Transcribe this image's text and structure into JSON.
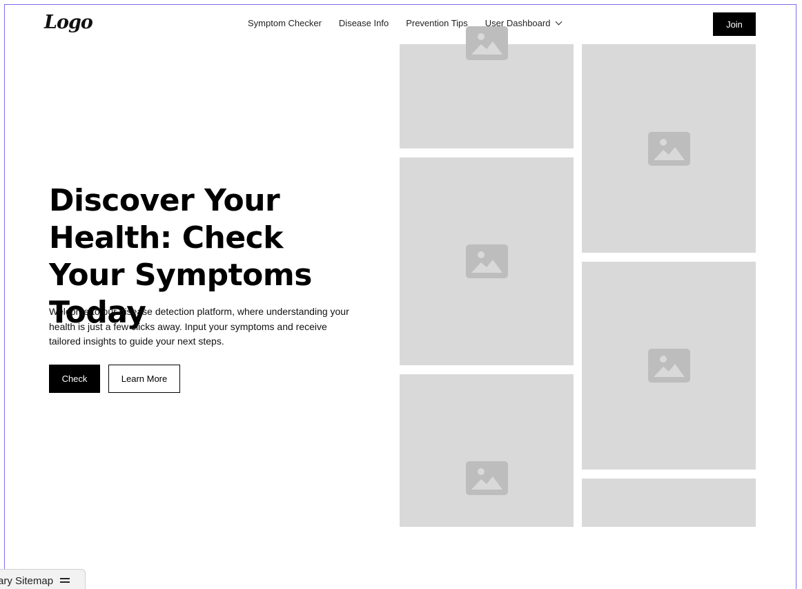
{
  "nav": {
    "logo": "Logo",
    "links": [
      "Symptom Checker",
      "Disease Info",
      "Prevention Tips"
    ],
    "dropdown_label": "User Dashboard",
    "join_label": "Join"
  },
  "hero": {
    "title": "Discover Your Health: Check Your Symptoms Today",
    "description": "Welcome to our disease detection platform, where understanding your health is just a few clicks away. Input your symptoms and receive tailored insights to guide your next steps.",
    "primary_button": "Check",
    "secondary_button": "Learn More"
  },
  "gallery": {
    "placeholder_icon": "image-placeholder-icon",
    "placeholder_color": "#d9d9d9",
    "icon_color": "#bdbdbd",
    "image_count": 6
  },
  "sitemap": {
    "label": "ary Sitemap",
    "icon": "menu-icon"
  },
  "colors": {
    "frame_border": "#7b6cf0",
    "primary": "#000000"
  }
}
